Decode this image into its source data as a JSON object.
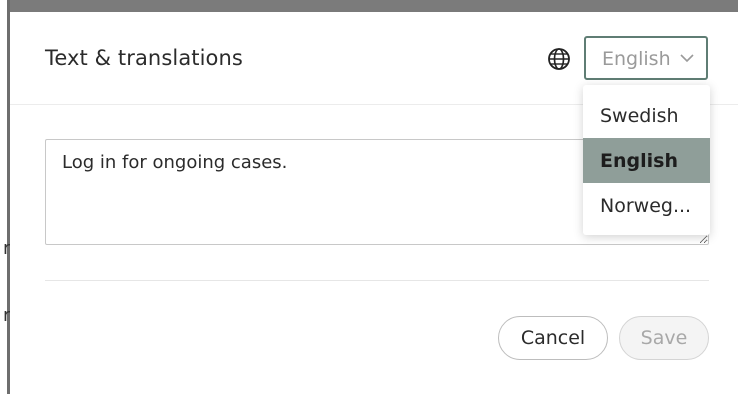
{
  "dialog": {
    "title": "Text & translations",
    "language_select": {
      "value": "English",
      "icon": "chevron-down-icon",
      "prefix_icon": "globe-icon"
    },
    "textarea": {
      "value": "Log in for ongoing cases."
    },
    "buttons": {
      "cancel_label": "Cancel",
      "save_label": "Save"
    }
  },
  "language_dropdown": {
    "options": [
      {
        "label": "Swedish",
        "selected": false
      },
      {
        "label": "English",
        "selected": true
      },
      {
        "label": "Norweg...",
        "selected": false
      }
    ]
  },
  "background_glyphs": [
    "r",
    "r"
  ],
  "colors": {
    "accent_border": "#5f7d74",
    "selected_option_bg": "#8f9e99",
    "backdrop": "#7a7a7a"
  }
}
